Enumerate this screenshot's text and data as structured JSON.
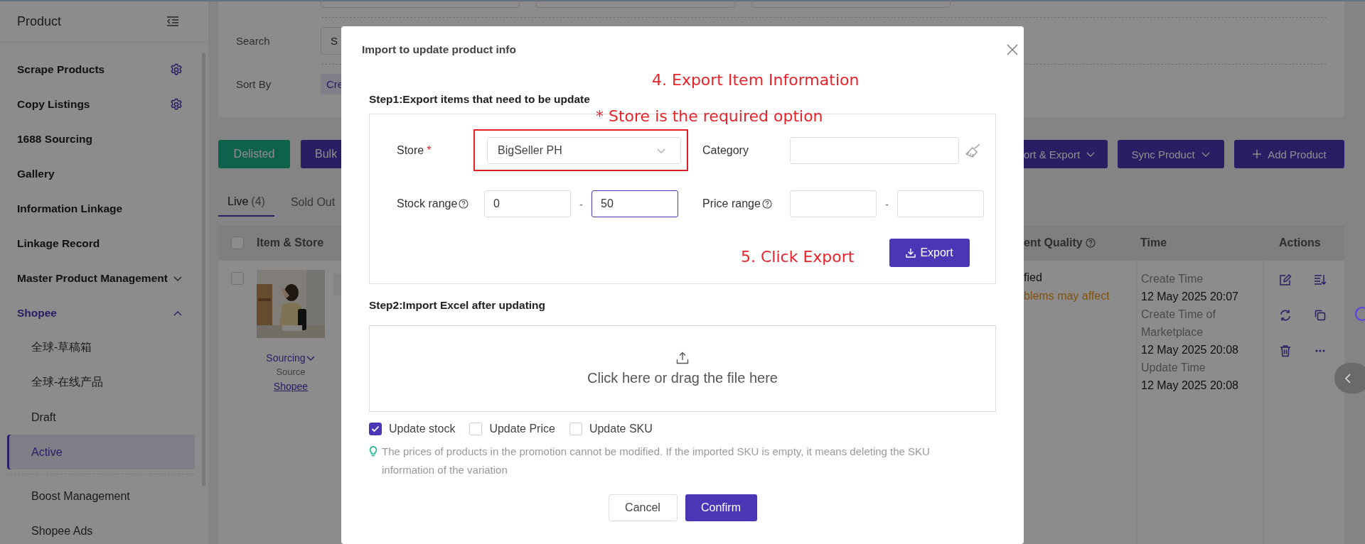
{
  "sidebar": {
    "title": "Product",
    "items": [
      {
        "label": "Scrape Products",
        "kind": "settings",
        "selected": false
      },
      {
        "label": "Copy Listings",
        "kind": "settings",
        "selected": false
      },
      {
        "label": "1688 Sourcing",
        "kind": "link",
        "selected": false
      },
      {
        "label": "Gallery",
        "kind": "link",
        "selected": false
      },
      {
        "label": "Information Linkage",
        "kind": "link",
        "selected": false
      },
      {
        "label": "Linkage Record",
        "kind": "link",
        "selected": false
      },
      {
        "label": "Master Product Management",
        "kind": "group",
        "expanded": false,
        "selected": false
      },
      {
        "label": "Shopee",
        "kind": "group",
        "expanded": true,
        "selected": false,
        "children": [
          {
            "label": "全球-草稿箱",
            "selected": false
          },
          {
            "label": "全球-在线产品",
            "selected": false
          },
          {
            "label": "Draft",
            "selected": false
          },
          {
            "label": "Active",
            "selected": true
          },
          {
            "label": "Boost Management",
            "selected": false,
            "divider_before": true
          },
          {
            "label": "Shopee Ads",
            "selected": false
          }
        ]
      }
    ]
  },
  "filter": {
    "top_fields": [
      {
        "kind": "input"
      },
      {
        "kind": "input"
      },
      {
        "kind": "input"
      }
    ],
    "search": {
      "label": "Search",
      "value": "S"
    },
    "sort": {
      "label": "Sort By",
      "option": "Cre",
      "selected": true
    }
  },
  "toolbar": [
    {
      "label": "Delisted",
      "kind": "success"
    },
    {
      "label": "Bulk",
      "kind": "primary"
    },
    {
      "label": "ort & Export",
      "kind": "dropdown"
    },
    {
      "label": "Sync Product",
      "kind": "dropdown"
    },
    {
      "label": "Add Product",
      "kind": "add"
    }
  ],
  "tabs": [
    {
      "label": "Live",
      "count": "(4)",
      "selected": true
    },
    {
      "label": "Sold Out",
      "selected": false
    }
  ],
  "table": {
    "select_all_checked": false,
    "columns": [
      {
        "label": "Item & Store",
        "kind": "text"
      },
      {
        "label": "ent Quality",
        "kind": "help"
      },
      {
        "label": "Time",
        "kind": "text"
      },
      {
        "label": "Actions",
        "kind": "text"
      }
    ],
    "rows": [
      {
        "checked": false,
        "image": {
          "kind": "picture"
        },
        "source_menu": "Sourcing",
        "source_label": "Source",
        "source_link": "Shopee",
        "quality": "fied",
        "quality_warning": "blems may affect",
        "times": [
          {
            "label": "Create Time",
            "value": "12 May 2025 20:07"
          },
          {
            "label": "Create Time of Marketplace",
            "value": "12 May 2025 20:08"
          },
          {
            "label": "Update Time",
            "value": "12 May 2025 20:08"
          }
        ],
        "actions": [
          {
            "kind": "edit"
          },
          {
            "kind": "sort"
          },
          {
            "kind": "sync"
          },
          {
            "kind": "copy"
          },
          {
            "kind": "delete"
          },
          {
            "kind": "more"
          }
        ]
      }
    ]
  },
  "modal": {
    "title": "Import to update product info",
    "annotations": [
      {
        "text": "4. Export Item Information",
        "kind": "step1"
      },
      {
        "text": "* Store is the required option",
        "kind": "store"
      },
      {
        "text": "5. Click Export",
        "kind": "export"
      }
    ],
    "step1": {
      "title": "Step1:Export items that need to be update",
      "store": {
        "label": "Store",
        "required_mark": "*",
        "value": "BigSeller PH",
        "highlighted": true
      },
      "category": {
        "label": "Category"
      },
      "stock_range": {
        "label": "Stock range",
        "help": true,
        "from": "0",
        "separator": "-",
        "to": "50",
        "to_focused": true
      },
      "price_range": {
        "label": "Price range",
        "help": true,
        "separator": "-"
      },
      "export_button": "Export"
    },
    "step2": {
      "title": "Step2:Import Excel after updating",
      "dropzone": "Click here or drag the file here",
      "options": [
        {
          "label": "Update stock",
          "checked": true
        },
        {
          "label": "Update Price",
          "checked": false
        },
        {
          "label": "Update SKU",
          "checked": false
        }
      ],
      "hint": "The prices of products in the promotion cannot be modified. If the imported SKU is empty, it means deleting the SKU information of the variation"
    },
    "buttons": [
      {
        "label": "Cancel",
        "kind": "default"
      },
      {
        "label": "Confirm",
        "kind": "primary"
      }
    ]
  }
}
